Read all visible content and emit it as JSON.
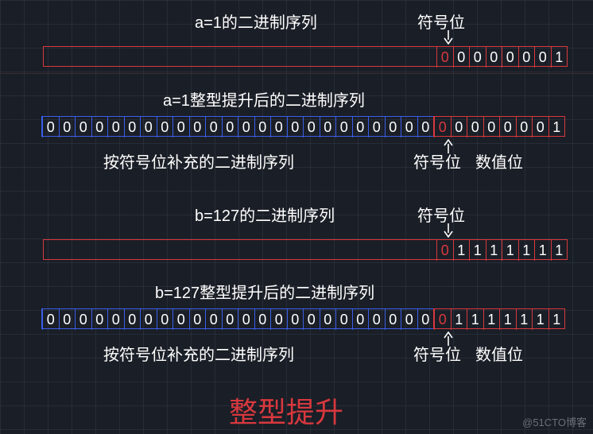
{
  "section_a": {
    "header_label": "a=1的二进制序列",
    "sign_label": "符号位",
    "bits8": [
      "0",
      "0",
      "0",
      "0",
      "0",
      "0",
      "0",
      "1"
    ],
    "promote_label": "a=1整型提升后的二进制序列",
    "pad_bits24": [
      "0",
      "0",
      "0",
      "0",
      "0",
      "0",
      "0",
      "0",
      "0",
      "0",
      "0",
      "0",
      "0",
      "0",
      "0",
      "0",
      "0",
      "0",
      "0",
      "0",
      "0",
      "0",
      "0",
      "0"
    ],
    "pad_label": "按符号位补充的二进制序列",
    "sign_label2": "符号位",
    "value_label": "数值位"
  },
  "section_b": {
    "header_label": "b=127的二进制序列",
    "sign_label": "符号位",
    "bits8": [
      "0",
      "1",
      "1",
      "1",
      "1",
      "1",
      "1",
      "1"
    ],
    "promote_label": "b=127整型提升后的二进制序列",
    "pad_bits24": [
      "0",
      "0",
      "0",
      "0",
      "0",
      "0",
      "0",
      "0",
      "0",
      "0",
      "0",
      "0",
      "0",
      "0",
      "0",
      "0",
      "0",
      "0",
      "0",
      "0",
      "0",
      "0",
      "0",
      "0"
    ],
    "pad_label": "按符号位补充的二进制序列",
    "sign_label2": "符号位",
    "value_label": "数值位"
  },
  "title": "整型提升",
  "watermark": "@51CTO博客"
}
